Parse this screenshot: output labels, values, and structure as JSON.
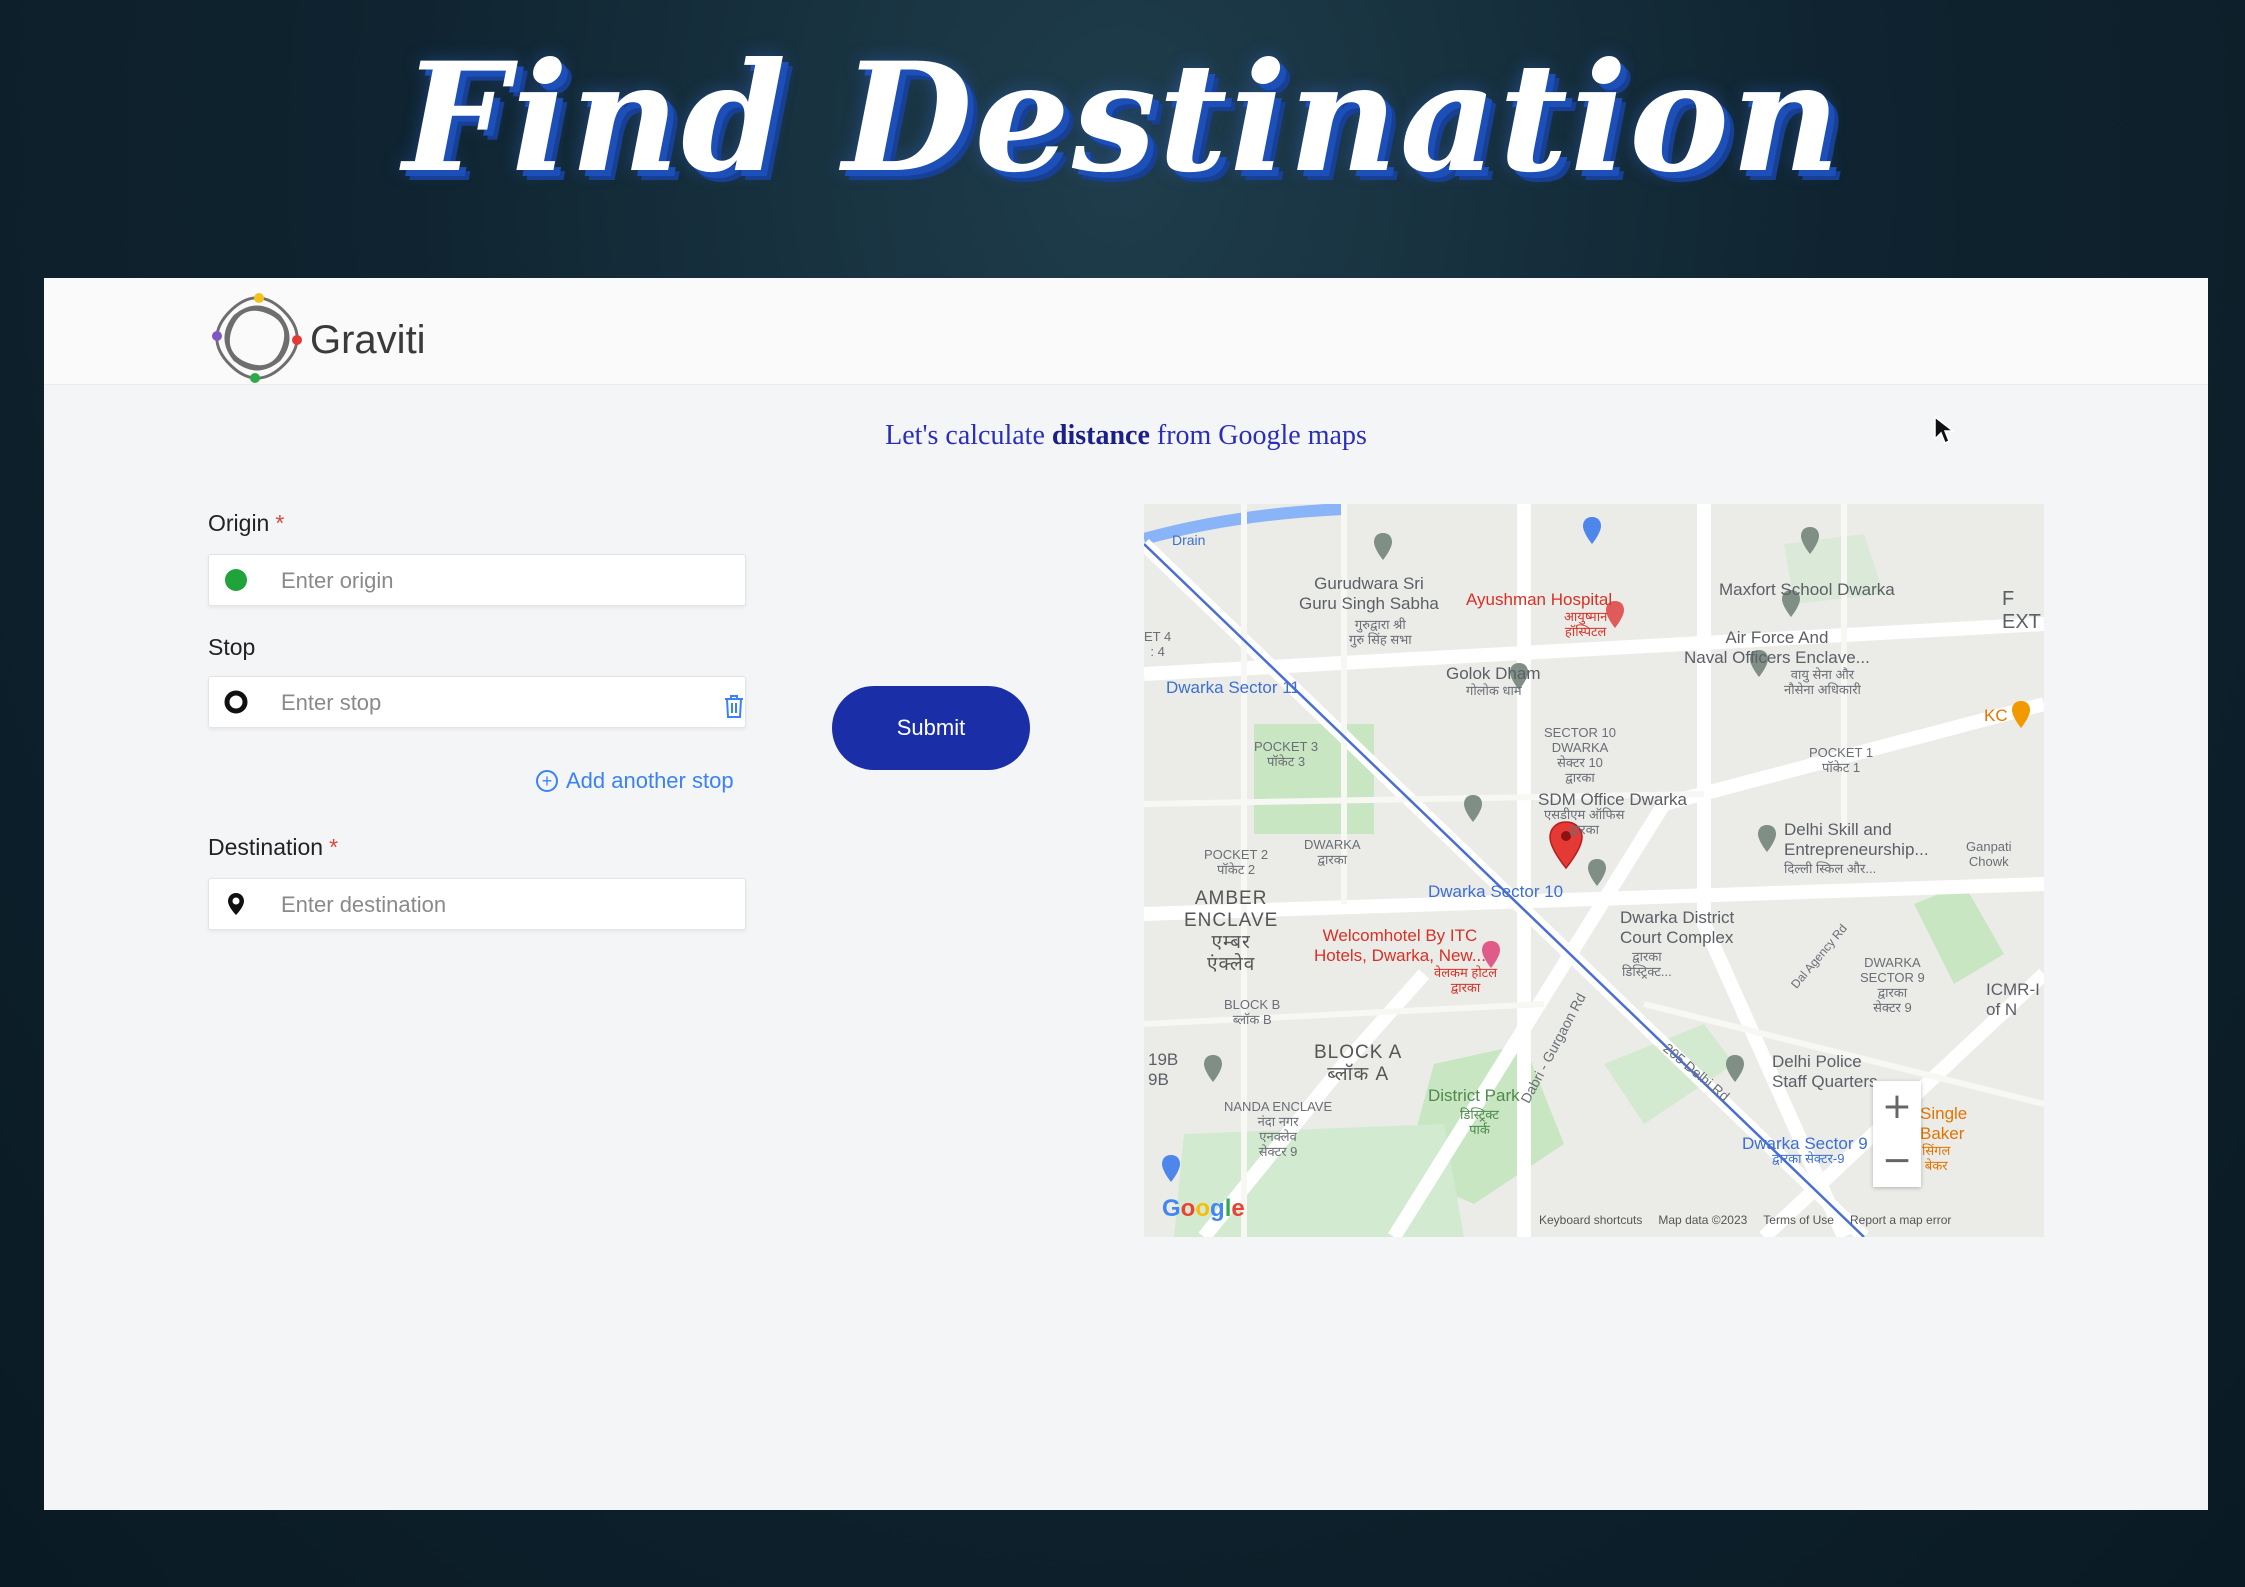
{
  "banner": {
    "title": "Find Destination"
  },
  "header": {
    "brand": "Graviti"
  },
  "subtitle": {
    "before": "Let's calculate ",
    "bold": "distance",
    "after": " from Google maps"
  },
  "form": {
    "origin": {
      "label": "Origin",
      "required": "*",
      "placeholder": "Enter origin"
    },
    "stop": {
      "label": "Stop",
      "placeholder": "Enter stop"
    },
    "add_stop_label": "Add another stop",
    "destination": {
      "label": "Destination",
      "required": "*",
      "placeholder": "Enter destination"
    },
    "submit_label": "Submit"
  },
  "map": {
    "labels": {
      "drain": "Drain",
      "gurudwara": "Gurudwara Sri\nGuru Singh Sabha",
      "gurudwara_hi": "गुरुद्वारा श्री\nगुरु सिंह सभा",
      "ayushman": "Ayushman Hospital",
      "ayushman_hi": "आयुष्मान\nहॉस्पिटल",
      "maxfort": "Maxfort School Dwarka",
      "airforce": "Air Force And\nNaval Officers Enclave...",
      "airforce_hi": "वायु सेना और\nनौसेना अधिकारी",
      "ext": "F\nEXT",
      "sector4": "ET 4\n: 4",
      "dwarka11": "Dwarka Sector 11",
      "golok": "Golok Dham",
      "golok_hi": "गोलोक धाम",
      "pocket3": "POCKET 3\nपॉकेट 3",
      "sector10": "SECTOR 10\nDWARKA\nसेक्टर 10\nद्वारका",
      "pocket1": "POCKET 1\nपॉकेट 1",
      "kc": "KC",
      "sdm": "SDM Office Dwarka",
      "sdm_hi": "एसडीएम ऑफिस\nद्वारका",
      "pocket2": "POCKET 2\nपॉकेट 2",
      "dwarka_mid": "DWARKA\nद्वारका",
      "delhi_skill": "Delhi Skill and\nEntrepreneurship...",
      "delhi_skill_hi": "दिल्ली स्किल और...",
      "ganpati": "Ganpati\nChowk",
      "dwarka10": "Dwarka Sector 10",
      "amber": "AMBER\nENCLAVE\nएम्बर\nएंक्लेव",
      "welcomhotel": "Welcomhotel By ITC\nHotels, Dwarka, New...",
      "welcomhotel_hi": "वेलकम होटल\nद्वारका",
      "court": "Dwarka District\nCourt Complex",
      "court_hi": "द्वारका\nडिस्ट्रिक्ट...",
      "sector9": "DWARKA\nSECTOR 9\nद्वारका\nसेक्टर 9",
      "icmr": "ICMR-I\nof N",
      "blockb": "BLOCK B\nब्लॉक B",
      "blocka": "BLOCK A\nब्लॉक A",
      "b19": "19B\n9B",
      "nanda": "NANDA ENCLAVE\nनंदा नगर\nएनक्लेव\nसेक्टर 9",
      "district_park": "District Park",
      "district_park_hi": "डिस्ट्रिक्ट\nपार्क",
      "dabri": "Dabri - Gurgaon Rd",
      "delhi_rd": "205 Delhi Rd",
      "dal_agency": "Dal Agency Rd",
      "police": "Delhi Police\nStaff Quarters",
      "dwarka9": "Dwarka Sector 9",
      "dwarka9_hi": "द्वारका सेक्टर-9",
      "baker": "Single\nBaker",
      "baker_hi": "सिंगल\nबेकर"
    },
    "zoom_in": "+",
    "zoom_out": "−",
    "google": [
      "G",
      "o",
      "o",
      "g",
      "l",
      "e"
    ],
    "footer": [
      "Keyboard shortcuts",
      "Map data ©2023",
      "Terms of Use",
      "Report a map error"
    ]
  },
  "colors": {
    "accent": "#1a2ea8",
    "origin_dot": "#1fa33a",
    "link": "#3b82f6",
    "required": "#e0453a"
  }
}
